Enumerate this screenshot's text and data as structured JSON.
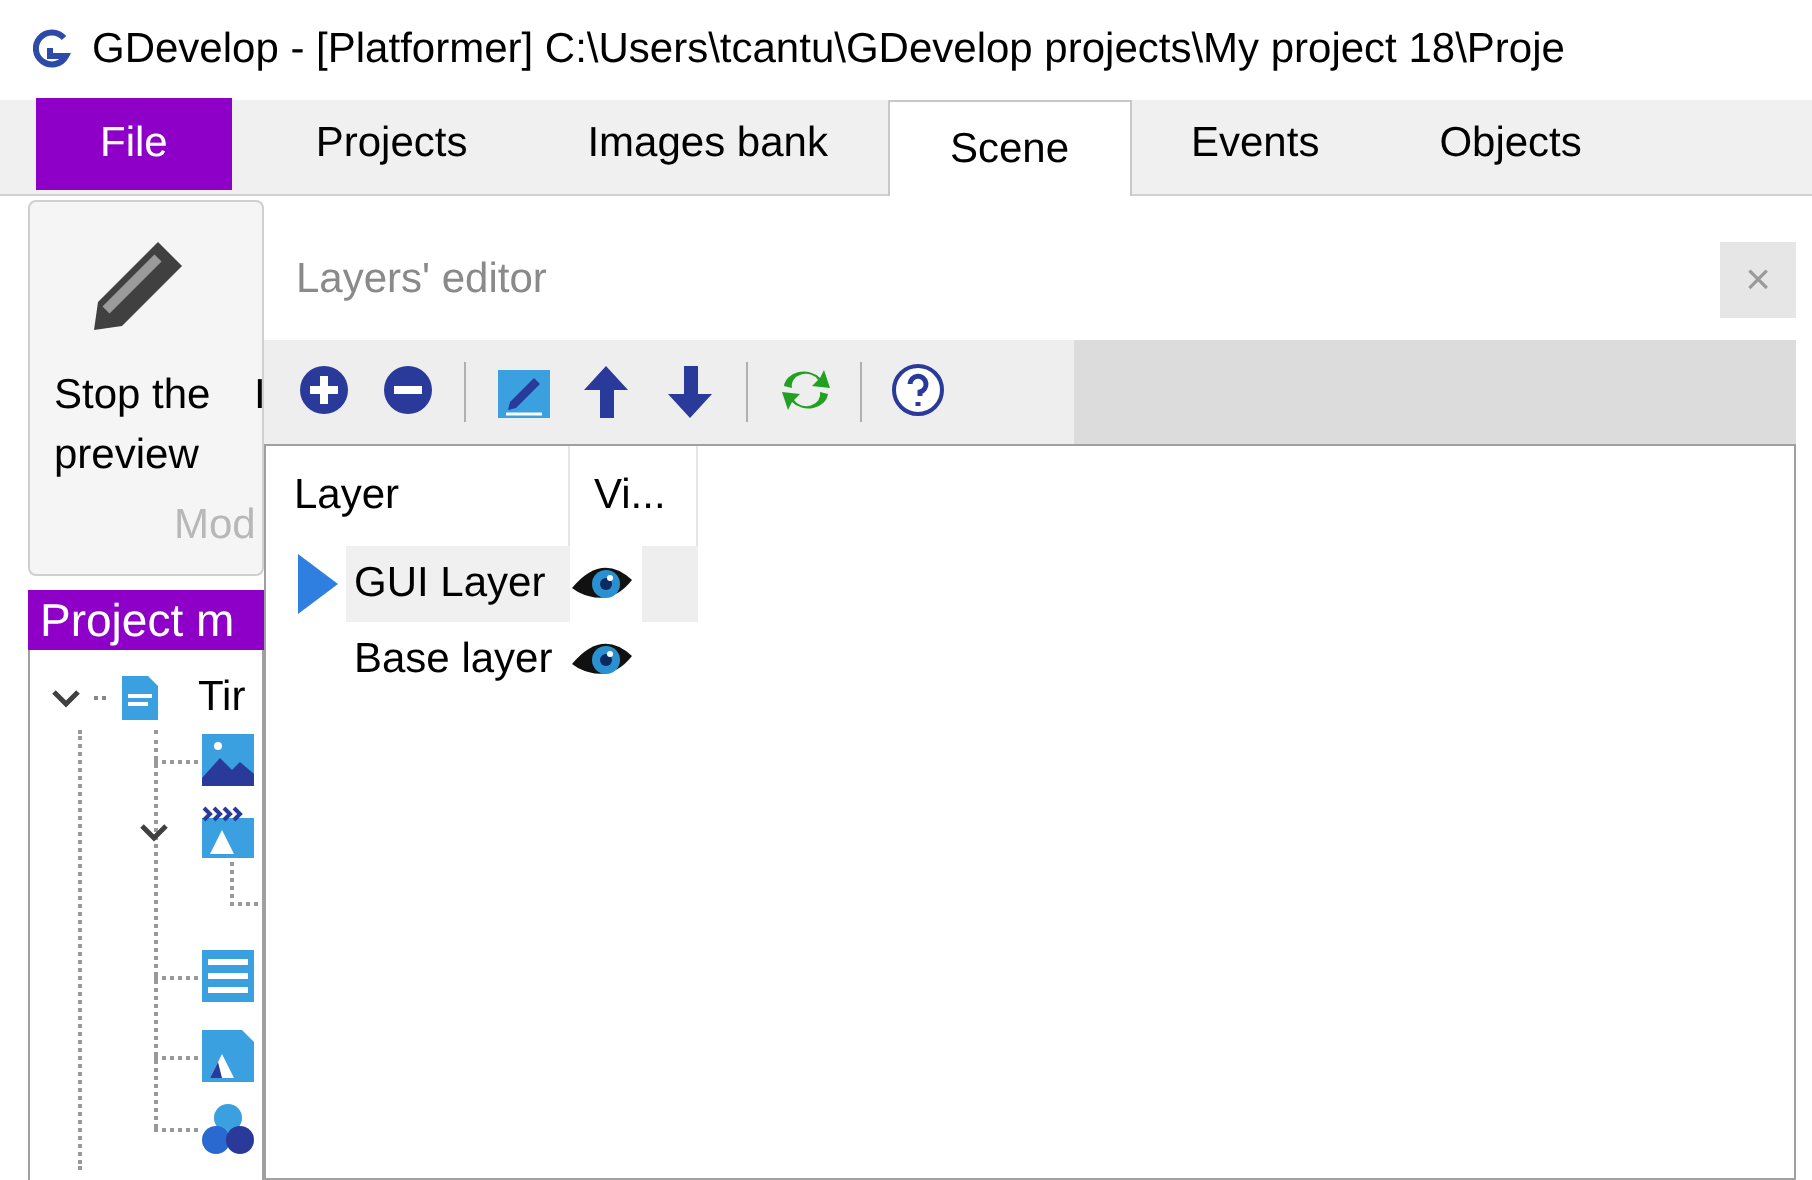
{
  "window": {
    "title": "GDevelop - [Platformer] C:\\Users\\tcantu\\GDevelop projects\\My project 18\\Proje"
  },
  "tabs": [
    {
      "label": "File",
      "kind": "file",
      "selected": false
    },
    {
      "label": "Projects",
      "kind": "tab",
      "selected": false
    },
    {
      "label": "Images bank",
      "kind": "tab",
      "selected": false
    },
    {
      "label": "Scene",
      "kind": "tab",
      "selected": true
    },
    {
      "label": "Events",
      "kind": "tab",
      "selected": false
    },
    {
      "label": "Objects",
      "kind": "tab",
      "selected": false
    }
  ],
  "ribbon": {
    "button": "Stop the preview",
    "partial_label": "I",
    "group_label": "Mod"
  },
  "project_manager": {
    "title": "Project m",
    "tree": [
      {
        "label": "Tir",
        "kind": "project",
        "expanded": true,
        "children": [
          {
            "kind": "image"
          },
          {
            "kind": "scene",
            "expanded": true
          },
          {
            "kind": "list"
          },
          {
            "kind": "object"
          },
          {
            "kind": "group"
          }
        ]
      }
    ]
  },
  "layers_editor": {
    "title": "Layers' editor",
    "close": "×",
    "toolbar": [
      {
        "kind": "add"
      },
      {
        "kind": "remove"
      },
      {
        "kind": "separator"
      },
      {
        "kind": "edit"
      },
      {
        "kind": "up"
      },
      {
        "kind": "down"
      },
      {
        "kind": "separator"
      },
      {
        "kind": "refresh"
      },
      {
        "kind": "separator"
      },
      {
        "kind": "help"
      }
    ],
    "columns": [
      "Layer",
      "Vi..."
    ],
    "rows": [
      {
        "name": "GUI Layer",
        "selected": true,
        "visible": true
      },
      {
        "name": "Base layer",
        "selected": false,
        "visible": true
      }
    ]
  }
}
